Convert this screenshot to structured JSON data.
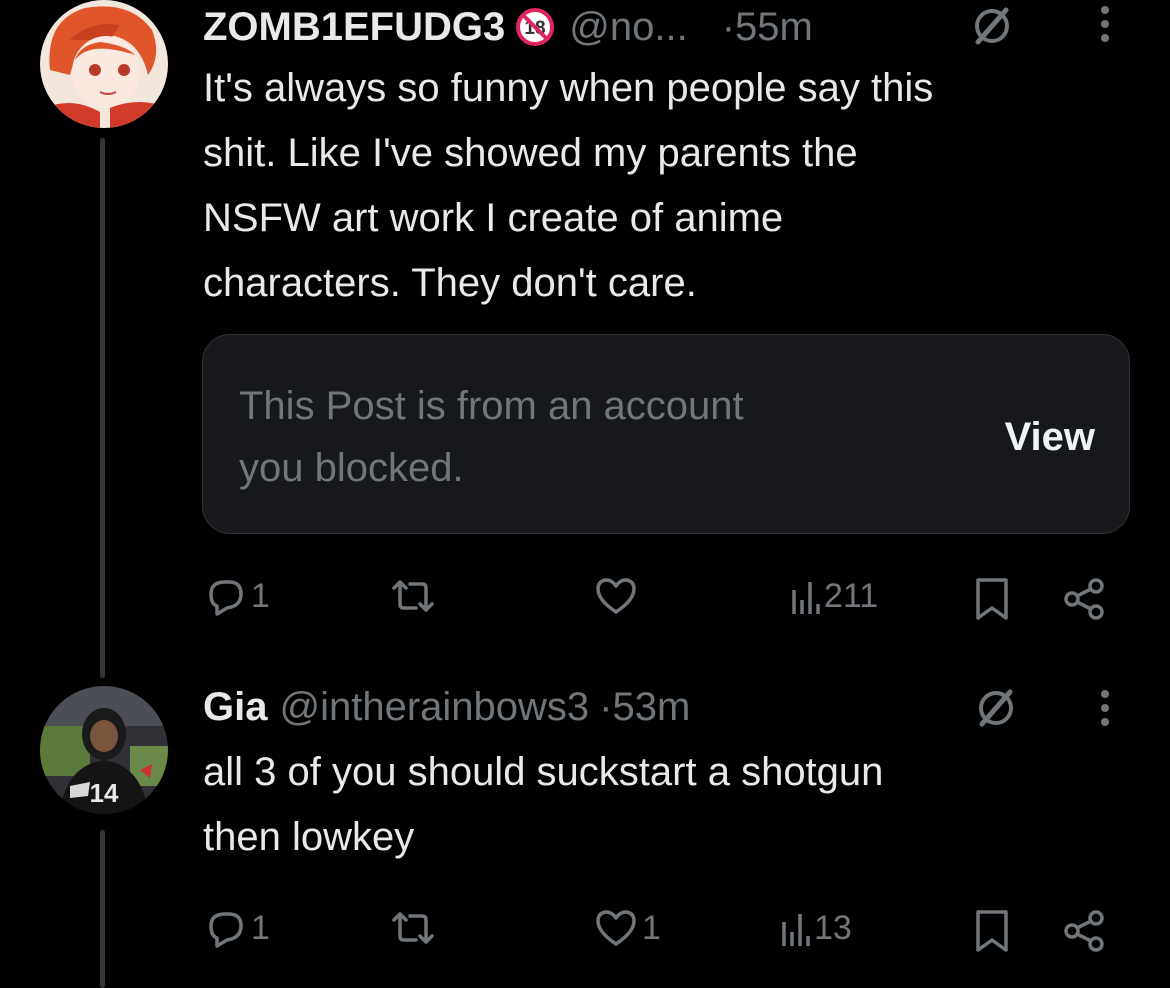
{
  "posts": [
    {
      "display_name": "ZOMB1EFUDG3",
      "badge": "18",
      "handle": "@no...",
      "time": "·55m",
      "text_lines": [
        "It's always so funny when people say this",
        "shit. Like I've showed my parents the",
        "NSFW art work I create of anime",
        "characters. They don't care."
      ],
      "notice": {
        "line1": "This Post is from an account",
        "line2": "you blocked.",
        "button": "View"
      },
      "stats": {
        "replies": "1",
        "reposts": "",
        "likes": "",
        "views": "211"
      }
    },
    {
      "display_name": "Gia",
      "handle": "@intherainbows3",
      "time": "·53m",
      "text_lines": [
        "all 3 of you should suckstart a shotgun",
        "then lowkey"
      ],
      "stats": {
        "replies": "1",
        "reposts": "",
        "likes": "1",
        "views": "13"
      }
    }
  ],
  "colors": {
    "background": "#000000",
    "text": "#e7e9ea",
    "muted": "#71767b",
    "notice_bg": "#16181c"
  },
  "icons": [
    "reply-icon",
    "repost-icon",
    "like-icon",
    "views-icon",
    "bookmark-icon",
    "share-icon",
    "grok-icon",
    "more-icon",
    "age-restricted-icon"
  ]
}
